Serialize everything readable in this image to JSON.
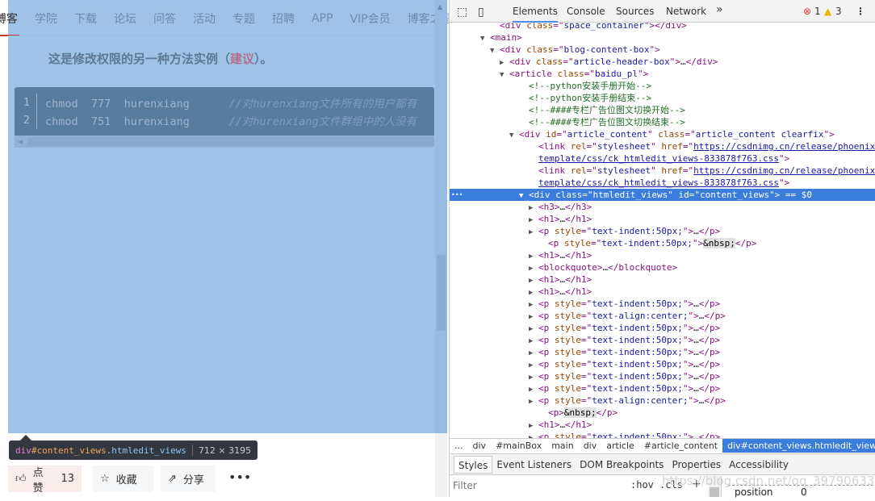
{
  "page": {
    "nav": [
      "博客",
      "学院",
      "下载",
      "论坛",
      "问答",
      "活动",
      "专题",
      "招聘",
      "APP",
      "VIP会员",
      "博客之星"
    ],
    "heading_pre": "这是修改权限的另一种方法实例（",
    "heading_link": "建议",
    "heading_post": "）。",
    "code": [
      {
        "n": "1",
        "cmd": "chmod",
        "mode": "777",
        "target": "hurenxiang",
        "comment": "//对hurenxiang文件所有的用户都有"
      },
      {
        "n": "2",
        "cmd": "chmod",
        "mode": "751",
        "target": "hurenxiang",
        "comment": "//对hurenxiang文件群组中的人没有"
      }
    ],
    "tooltip": {
      "tag": "div",
      "id": "#content_views",
      "cls": ".htmledit_views",
      "dims": "712 × 3195"
    },
    "actions": {
      "like": "点赞",
      "like_count": "13",
      "fav": "收藏",
      "share": "分享",
      "more": "•••"
    }
  },
  "devtools": {
    "tabs": [
      "Elements",
      "Console",
      "Sources",
      "Network"
    ],
    "overflow": "»",
    "errors": "1",
    "warnings": "3",
    "rows": [
      {
        "i": 62,
        "s": [
          [
            "tg",
            "<div "
          ],
          [
            "an",
            "class"
          ],
          [
            "tg",
            "=\""
          ],
          [
            "av",
            "space_container"
          ],
          [
            "tg",
            "\"></div>"
          ]
        ]
      },
      {
        "i": 50,
        "a": "▼",
        "s": [
          [
            "tg",
            "<main>"
          ]
        ]
      },
      {
        "i": 62,
        "a": "▼",
        "s": [
          [
            "tg",
            "<div "
          ],
          [
            "an",
            "class"
          ],
          [
            "tg",
            "=\""
          ],
          [
            "av",
            "blog-content-box"
          ],
          [
            "tg",
            "\">"
          ]
        ]
      },
      {
        "i": 74,
        "a": "▶",
        "s": [
          [
            "tg",
            "<div "
          ],
          [
            "an",
            "class"
          ],
          [
            "tg",
            "=\""
          ],
          [
            "av",
            "article-header-box"
          ],
          [
            "tg",
            "\">"
          ],
          [
            "tx",
            "…"
          ],
          [
            "tg",
            "</div>"
          ]
        ]
      },
      {
        "i": 74,
        "a": "▼",
        "s": [
          [
            "tg",
            "<article "
          ],
          [
            "an",
            "class"
          ],
          [
            "tg",
            "=\""
          ],
          [
            "av",
            "baidu_pl"
          ],
          [
            "tg",
            "\">"
          ]
        ]
      },
      {
        "i": 98,
        "s": [
          [
            "cmt",
            "<!--python安装手册开始-->"
          ]
        ]
      },
      {
        "i": 98,
        "s": [
          [
            "cmt",
            "<!--python安装手册结束-->"
          ]
        ]
      },
      {
        "i": 98,
        "s": [
          [
            "cmt",
            "<!--####专栏广告位图文切换开始-->"
          ]
        ]
      },
      {
        "i": 98,
        "s": [
          [
            "cmt",
            "<!--####专栏广告位图文切换结束-->"
          ]
        ]
      },
      {
        "i": 86,
        "a": "▼",
        "s": [
          [
            "tg",
            "<div "
          ],
          [
            "an",
            "id"
          ],
          [
            "tg",
            "=\""
          ],
          [
            "av",
            "article_content"
          ],
          [
            "tg",
            "\" "
          ],
          [
            "an",
            "class"
          ],
          [
            "tg",
            "=\""
          ],
          [
            "av",
            "article_content clearfix"
          ],
          [
            "tg",
            "\">"
          ]
        ]
      },
      {
        "i": 110,
        "s": [
          [
            "tg",
            "<link "
          ],
          [
            "an",
            "rel"
          ],
          [
            "tg",
            "=\""
          ],
          [
            "av",
            "stylesheet"
          ],
          [
            "tg",
            "\" "
          ],
          [
            "an",
            "href"
          ],
          [
            "tg",
            "=\""
          ],
          [
            "lk",
            "https://csdnimg.cn/release/phoenix/"
          ]
        ]
      },
      {
        "i": 110,
        "s": [
          [
            "lk",
            "template/css/ck_htmledit_views-833878f763.css"
          ],
          [
            "tg",
            "\">"
          ]
        ]
      },
      {
        "i": 110,
        "s": [
          [
            "tg",
            "<link "
          ],
          [
            "an",
            "rel"
          ],
          [
            "tg",
            "=\""
          ],
          [
            "av",
            "stylesheet"
          ],
          [
            "tg",
            "\" "
          ],
          [
            "an",
            "href"
          ],
          [
            "tg",
            "=\""
          ],
          [
            "lk",
            "https://csdnimg.cn/release/phoenix/"
          ]
        ]
      },
      {
        "i": 110,
        "s": [
          [
            "lk",
            "template/css/ck_htmledit_views-833878f763.css"
          ],
          [
            "tg",
            "\">"
          ]
        ]
      },
      {
        "i": 98,
        "a": "▼",
        "sel": true,
        "s": [
          [
            "tg",
            "<div "
          ],
          [
            "an",
            "class"
          ],
          [
            "tg",
            "=\""
          ],
          [
            "av",
            "htmledit_views"
          ],
          [
            "tg",
            "\" "
          ],
          [
            "an",
            "id"
          ],
          [
            "tg",
            "=\""
          ],
          [
            "av",
            "content_views"
          ],
          [
            "tg",
            "\">"
          ],
          [
            "tx",
            " == $0"
          ]
        ]
      },
      {
        "i": 110,
        "a": "▶",
        "s": [
          [
            "tg",
            "<h3>"
          ],
          [
            "tx",
            "…"
          ],
          [
            "tg",
            "</h3>"
          ]
        ]
      },
      {
        "i": 110,
        "a": "▶",
        "s": [
          [
            "tg",
            "<h1>"
          ],
          [
            "tx",
            "…"
          ],
          [
            "tg",
            "</h1>"
          ]
        ]
      },
      {
        "i": 110,
        "a": "▶",
        "s": [
          [
            "tg",
            "<p "
          ],
          [
            "an",
            "style"
          ],
          [
            "tg",
            "=\""
          ],
          [
            "av",
            "text-indent:50px;"
          ],
          [
            "tg",
            "\">"
          ],
          [
            "tx",
            "…"
          ],
          [
            "tg",
            "</p>"
          ]
        ]
      },
      {
        "i": 122,
        "s": [
          [
            "tg",
            "<p "
          ],
          [
            "an",
            "style"
          ],
          [
            "tg",
            "=\""
          ],
          [
            "av",
            "text-indent:50px;"
          ],
          [
            "tg",
            "\">"
          ],
          [
            "nb",
            "&nbsp;"
          ],
          [
            "tg",
            "</p>"
          ]
        ]
      },
      {
        "i": 110,
        "a": "▶",
        "s": [
          [
            "tg",
            "<h1>"
          ],
          [
            "tx",
            "…"
          ],
          [
            "tg",
            "</h1>"
          ]
        ]
      },
      {
        "i": 110,
        "a": "▶",
        "s": [
          [
            "tg",
            "<blockquote>"
          ],
          [
            "tx",
            "…"
          ],
          [
            "tg",
            "</blockquote>"
          ]
        ]
      },
      {
        "i": 110,
        "a": "▶",
        "s": [
          [
            "tg",
            "<h1>"
          ],
          [
            "tx",
            "…"
          ],
          [
            "tg",
            "</h1>"
          ]
        ]
      },
      {
        "i": 110,
        "a": "▶",
        "s": [
          [
            "tg",
            "<h1>"
          ],
          [
            "tx",
            "…"
          ],
          [
            "tg",
            "</h1>"
          ]
        ]
      },
      {
        "i": 110,
        "a": "▶",
        "s": [
          [
            "tg",
            "<p "
          ],
          [
            "an",
            "style"
          ],
          [
            "tg",
            "=\""
          ],
          [
            "av",
            "text-indent:50px;"
          ],
          [
            "tg",
            "\">"
          ],
          [
            "tx",
            "…"
          ],
          [
            "tg",
            "</p>"
          ]
        ]
      },
      {
        "i": 110,
        "a": "▶",
        "s": [
          [
            "tg",
            "<p "
          ],
          [
            "an",
            "style"
          ],
          [
            "tg",
            "=\""
          ],
          [
            "av",
            "text-align:center;"
          ],
          [
            "tg",
            "\">"
          ],
          [
            "tx",
            "…"
          ],
          [
            "tg",
            "</p>"
          ]
        ]
      },
      {
        "i": 110,
        "a": "▶",
        "s": [
          [
            "tg",
            "<p "
          ],
          [
            "an",
            "style"
          ],
          [
            "tg",
            "=\""
          ],
          [
            "av",
            "text-indent:50px;"
          ],
          [
            "tg",
            "\">"
          ],
          [
            "tx",
            "…"
          ],
          [
            "tg",
            "</p>"
          ]
        ]
      },
      {
        "i": 110,
        "a": "▶",
        "s": [
          [
            "tg",
            "<p "
          ],
          [
            "an",
            "style"
          ],
          [
            "tg",
            "=\""
          ],
          [
            "av",
            "text-indent:50px;"
          ],
          [
            "tg",
            "\">"
          ],
          [
            "tx",
            "…"
          ],
          [
            "tg",
            "</p>"
          ]
        ]
      },
      {
        "i": 110,
        "a": "▶",
        "s": [
          [
            "tg",
            "<p "
          ],
          [
            "an",
            "style"
          ],
          [
            "tg",
            "=\""
          ],
          [
            "av",
            "text-indent:50px;"
          ],
          [
            "tg",
            "\">"
          ],
          [
            "tx",
            "…"
          ],
          [
            "tg",
            "</p>"
          ]
        ]
      },
      {
        "i": 110,
        "a": "▶",
        "s": [
          [
            "tg",
            "<p "
          ],
          [
            "an",
            "style"
          ],
          [
            "tg",
            "=\""
          ],
          [
            "av",
            "text-indent:50px;"
          ],
          [
            "tg",
            "\">"
          ],
          [
            "tx",
            "…"
          ],
          [
            "tg",
            "</p>"
          ]
        ]
      },
      {
        "i": 110,
        "a": "▶",
        "s": [
          [
            "tg",
            "<p "
          ],
          [
            "an",
            "style"
          ],
          [
            "tg",
            "=\""
          ],
          [
            "av",
            "text-indent:50px;"
          ],
          [
            "tg",
            "\">"
          ],
          [
            "tx",
            "…"
          ],
          [
            "tg",
            "</p>"
          ]
        ]
      },
      {
        "i": 110,
        "a": "▶",
        "s": [
          [
            "tg",
            "<p "
          ],
          [
            "an",
            "style"
          ],
          [
            "tg",
            "=\""
          ],
          [
            "av",
            "text-indent:50px;"
          ],
          [
            "tg",
            "\">"
          ],
          [
            "tx",
            "…"
          ],
          [
            "tg",
            "</p>"
          ]
        ]
      },
      {
        "i": 110,
        "a": "▶",
        "s": [
          [
            "tg",
            "<p "
          ],
          [
            "an",
            "style"
          ],
          [
            "tg",
            "=\""
          ],
          [
            "av",
            "text-align:center;"
          ],
          [
            "tg",
            "\">"
          ],
          [
            "tx",
            "…"
          ],
          [
            "tg",
            "</p>"
          ]
        ]
      },
      {
        "i": 122,
        "s": [
          [
            "tg",
            "<p>"
          ],
          [
            "nb",
            "&nbsp;"
          ],
          [
            "tg",
            "</p>"
          ]
        ]
      },
      {
        "i": 110,
        "a": "▶",
        "s": [
          [
            "tg",
            "<h1>"
          ],
          [
            "tx",
            "…"
          ],
          [
            "tg",
            "</h1>"
          ]
        ]
      },
      {
        "i": 110,
        "a": "▶",
        "s": [
          [
            "tg",
            "<p "
          ],
          [
            "an",
            "style"
          ],
          [
            "tg",
            "=\""
          ],
          [
            "av",
            "text-indent:50px;"
          ],
          [
            "tg",
            "\">"
          ],
          [
            "tx",
            "…"
          ],
          [
            "tg",
            "</p>"
          ]
        ]
      }
    ],
    "breadcrumb": [
      "...",
      "div",
      "#mainBox",
      "main",
      "div",
      "article",
      "#article_content",
      "div#content_views.htmledit_views"
    ],
    "subtabs": [
      "Styles",
      "Event Listeners",
      "DOM Breakpoints",
      "Properties",
      "Accessibility"
    ],
    "filter_placeholder": "Filter",
    "hov": ":hov",
    "cls": ".cls",
    "plus": "+",
    "box_label": "position",
    "box_value": "0",
    "watermark": "https://blog.csdn.net/qq_39790633"
  }
}
